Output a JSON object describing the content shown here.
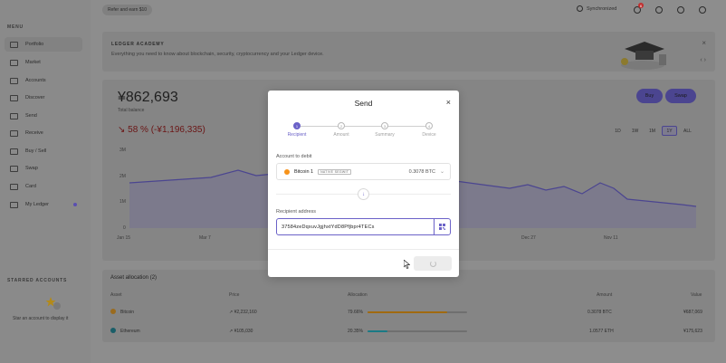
{
  "topbar": {
    "referral": "Refer and earn $10",
    "sync_status": "Synchronized",
    "notification_count": "6"
  },
  "sidebar": {
    "menu_label": "MENU",
    "items": [
      {
        "label": "Portfolio",
        "icon": "portfolio-icon",
        "active": true
      },
      {
        "label": "Market",
        "icon": "market-icon"
      },
      {
        "label": "Accounts",
        "icon": "accounts-icon"
      },
      {
        "label": "Discover",
        "icon": "discover-icon"
      },
      {
        "label": "Send",
        "icon": "send-icon"
      },
      {
        "label": "Receive",
        "icon": "receive-icon"
      },
      {
        "label": "Buy / Sell",
        "icon": "buy-sell-icon"
      },
      {
        "label": "Swap",
        "icon": "swap-icon"
      },
      {
        "label": "Card",
        "icon": "card-icon"
      },
      {
        "label": "My Ledger",
        "icon": "ledger-icon"
      }
    ],
    "starred_label": "STARRED ACCOUNTS",
    "starred_empty": "Star an account to display it"
  },
  "banner": {
    "title": "LEDGER ACADEMY",
    "subtitle": "Everything you need to know about blockchain, security, cryptocurrency and your Ledger device.",
    "close": "×",
    "nav": "‹ ›"
  },
  "portfolio": {
    "balance": "¥862,693",
    "balance_label": "Total balance",
    "change": "↘ 58 % (-¥1,196,335)",
    "buy": "Buy",
    "swap": "Swap",
    "ranges": [
      "1D",
      "1W",
      "1M",
      "1Y",
      "ALL"
    ],
    "selected_range": "1Y",
    "y_ticks": [
      "3M",
      "2M",
      "1M",
      "0"
    ],
    "x_ticks": [
      "Jan 15",
      "Mar 7",
      "Dec 27",
      "Nov 11"
    ]
  },
  "allocation": {
    "title": "Asset allocation (2)",
    "headers": {
      "asset": "Asset",
      "price": "Price",
      "allocation": "Allocation",
      "amount": "Amount",
      "value": "Value"
    },
    "rows": [
      {
        "asset": "Bitcoin",
        "price": "↗ ¥2,232,160",
        "allocation": "79.66%",
        "share": 0.7966,
        "amount": "0.3078 BTC",
        "value": "¥687,069",
        "color": "#f7931a"
      },
      {
        "asset": "Ethereum",
        "price": "↗ ¥105,030",
        "allocation": "20.35%",
        "share": 0.2035,
        "amount": "1.0577 ETH",
        "value": "¥175,623",
        "color": "#0ebdcd"
      }
    ]
  },
  "modal": {
    "title": "Send",
    "close": "×",
    "steps": [
      {
        "num": "1",
        "label": "Recipient",
        "active": true
      },
      {
        "num": "2",
        "label": "Amount"
      },
      {
        "num": "3",
        "label": "Summary"
      },
      {
        "num": "4",
        "label": "Device"
      }
    ],
    "debit_label": "Account to debit",
    "account_name": "Bitcoin 1",
    "account_tag": "NATIVE SEGWIT",
    "account_balance": "0.3078 BTC",
    "arrow": "↓",
    "recipient_label": "Recipient address",
    "recipient_value": "37584zeDqxuvJgjhxtYdD8Pfjbpr4TECs"
  }
}
